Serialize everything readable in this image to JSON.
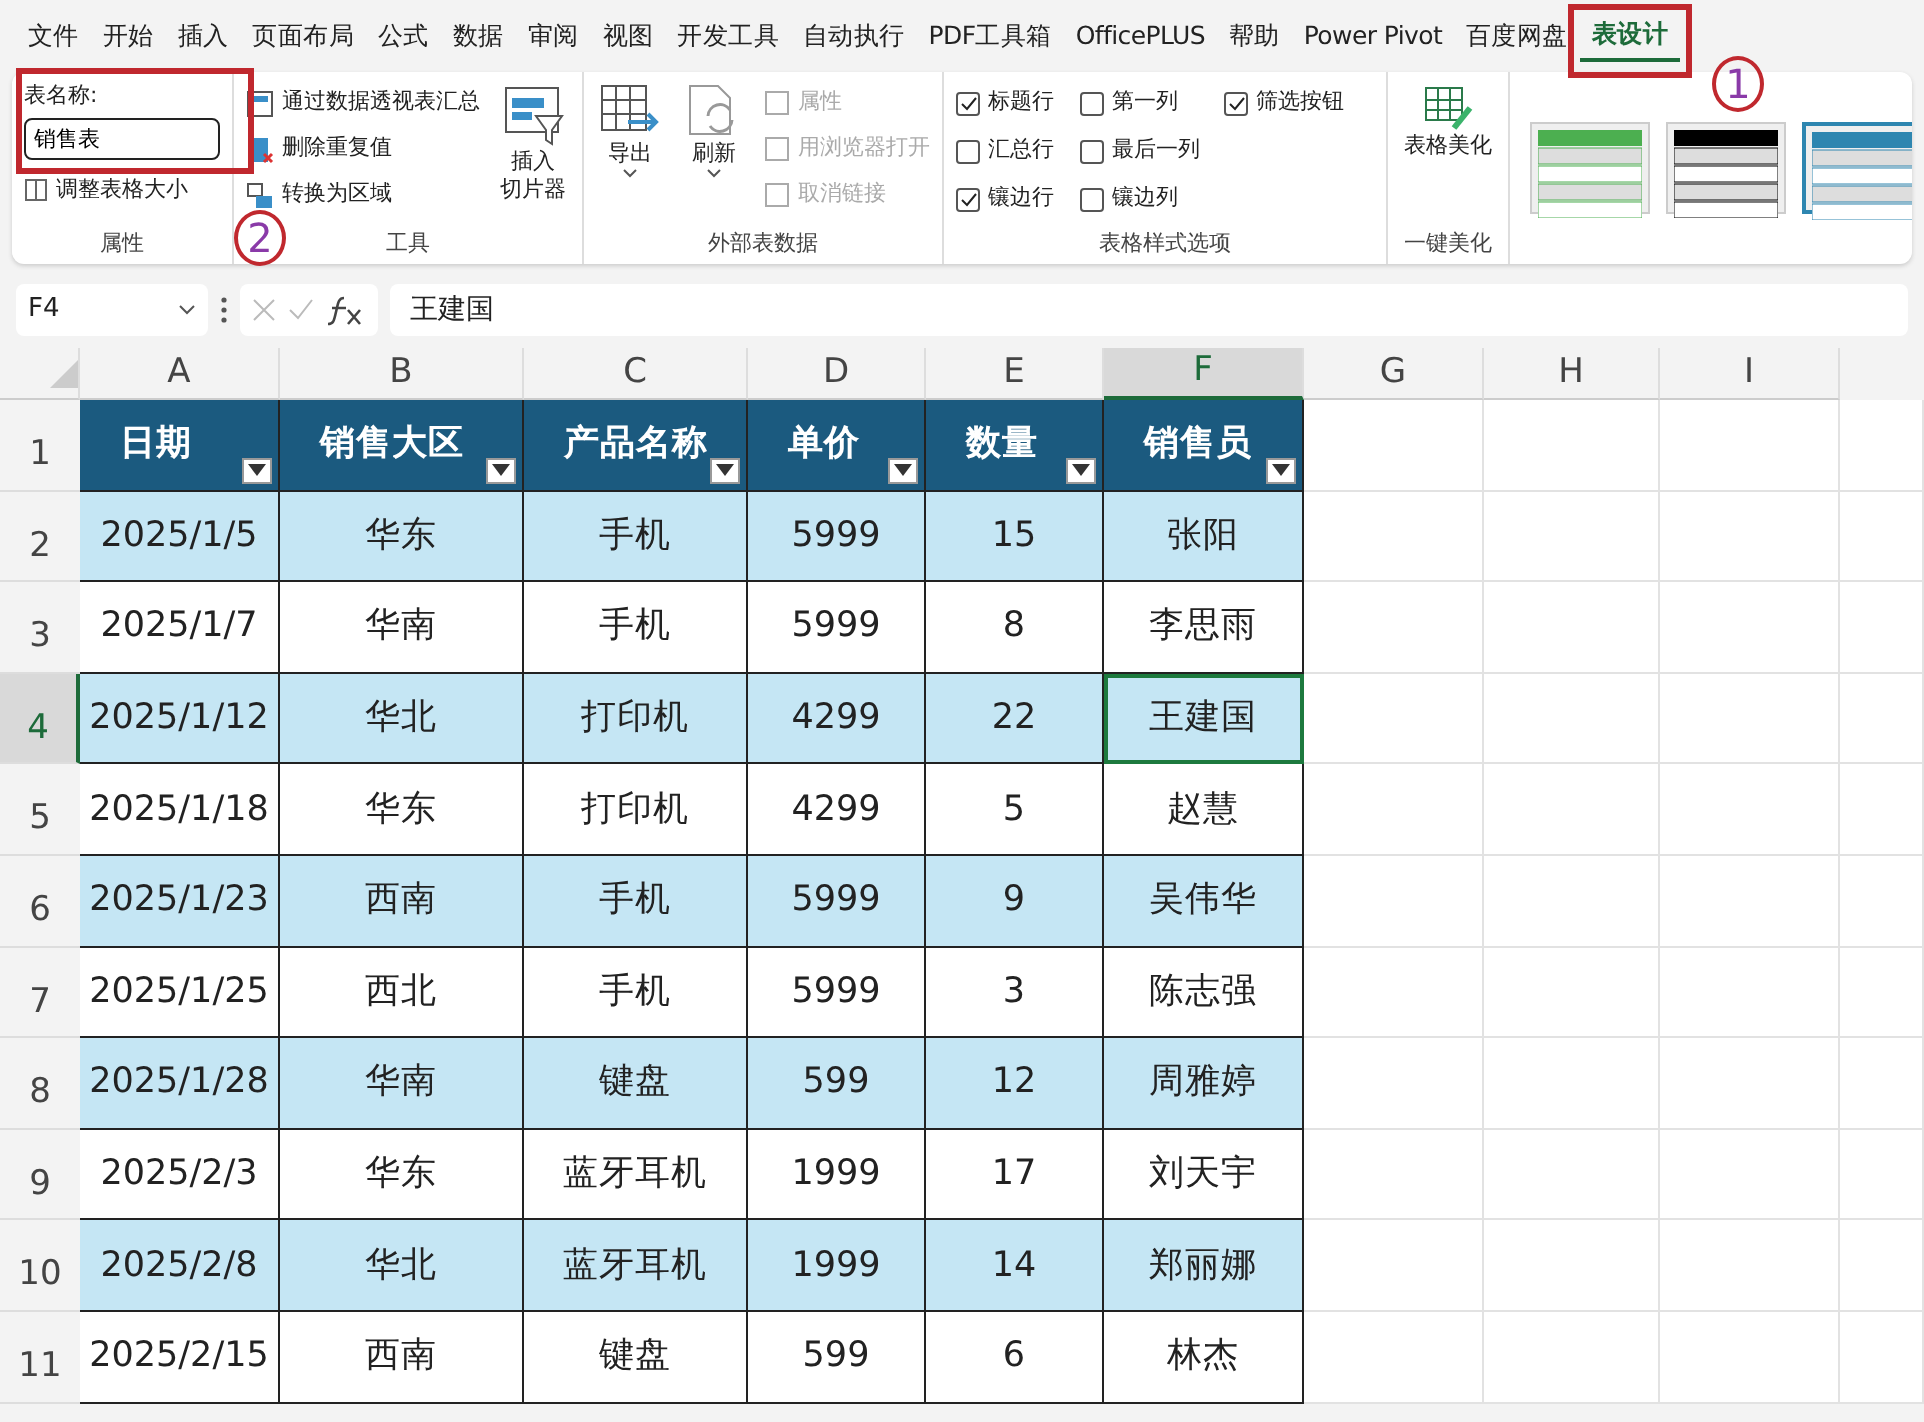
{
  "menu_tabs": [
    {
      "label": "文件",
      "selected": false
    },
    {
      "label": "开始",
      "selected": false
    },
    {
      "label": "插入",
      "selected": false
    },
    {
      "label": "页面布局",
      "selected": false
    },
    {
      "label": "公式",
      "selected": false
    },
    {
      "label": "数据",
      "selected": false
    },
    {
      "label": "审阅",
      "selected": false
    },
    {
      "label": "视图",
      "selected": false
    },
    {
      "label": "开发工具",
      "selected": false
    },
    {
      "label": "自动执行",
      "selected": false
    },
    {
      "label": "PDF工具箱",
      "selected": false
    },
    {
      "label": "OfficePLUS",
      "selected": false
    },
    {
      "label": "帮助",
      "selected": false
    },
    {
      "label": "Power Pivot",
      "selected": false
    },
    {
      "label": "百度网盘",
      "selected": false
    },
    {
      "label": "表设计",
      "selected": true
    }
  ],
  "ribbon": {
    "properties": {
      "name_label": "表名称:",
      "name_value": "销售表",
      "resize": "调整表格大小",
      "group": "属性"
    },
    "tools": {
      "items": [
        {
          "label": "通过数据透视表汇总",
          "kind": "pivot"
        },
        {
          "label": "删除重复值",
          "kind": "dedupe"
        },
        {
          "label": "转换为区域",
          "kind": "range"
        }
      ],
      "slicer": [
        "插入",
        "切片器"
      ],
      "group": "工具"
    },
    "external": {
      "export": "导出",
      "refresh": "刷新",
      "items": [
        {
          "label": "属性",
          "disabled": true
        },
        {
          "label": "用浏览器打开",
          "disabled": true
        },
        {
          "label": "取消链接",
          "disabled": true
        }
      ],
      "group": "外部表数据"
    },
    "style_options": {
      "options": [
        {
          "label": "标题行",
          "checked": true
        },
        {
          "label": "第一列",
          "checked": false
        },
        {
          "label": "筛选按钮",
          "checked": true
        },
        {
          "label": "汇总行",
          "checked": false
        },
        {
          "label": "最后一列",
          "checked": false
        },
        {
          "label": "镶边行",
          "checked": true
        },
        {
          "label": "镶边列",
          "checked": false
        }
      ],
      "group": "表格样式选项"
    },
    "beautify": {
      "button": "表格美化",
      "group": "一键美化"
    },
    "gallery": [
      {
        "color": "#4caf50",
        "selected": false
      },
      {
        "color": "#000000",
        "selected": false
      },
      {
        "color": "#2e86b0",
        "selected": true
      }
    ]
  },
  "formula_bar": {
    "name_box": "F4",
    "formula": "王建国"
  },
  "columns": [
    {
      "label": "A",
      "selected": false
    },
    {
      "label": "B",
      "selected": false
    },
    {
      "label": "C",
      "selected": false
    },
    {
      "label": "D",
      "selected": false
    },
    {
      "label": "E",
      "selected": false
    },
    {
      "label": "F",
      "selected": true
    },
    {
      "label": "G",
      "selected": false
    },
    {
      "label": "H",
      "selected": false
    },
    {
      "label": "I",
      "selected": false
    }
  ],
  "table": {
    "headers": [
      "日期",
      "销售大区",
      "产品名称",
      "单价",
      "数量",
      "销售员"
    ],
    "rows": [
      {
        "number": "2",
        "selected": false,
        "cells": [
          "2025/1/5",
          "华东",
          "手机",
          "5999",
          "15",
          "张阳"
        ]
      },
      {
        "number": "3",
        "selected": false,
        "cells": [
          "2025/1/7",
          "华南",
          "手机",
          "5999",
          "8",
          "李思雨"
        ]
      },
      {
        "number": "4",
        "selected": true,
        "cells": [
          "2025/1/12",
          "华北",
          "打印机",
          "4299",
          "22",
          "王建国"
        ]
      },
      {
        "number": "5",
        "selected": false,
        "cells": [
          "2025/1/18",
          "华东",
          "打印机",
          "4299",
          "5",
          "赵慧"
        ]
      },
      {
        "number": "6",
        "selected": false,
        "cells": [
          "2025/1/23",
          "西南",
          "手机",
          "5999",
          "9",
          "吴伟华"
        ]
      },
      {
        "number": "7",
        "selected": false,
        "cells": [
          "2025/1/25",
          "西北",
          "手机",
          "5999",
          "3",
          "陈志强"
        ]
      },
      {
        "number": "8",
        "selected": false,
        "cells": [
          "2025/1/28",
          "华南",
          "键盘",
          "599",
          "12",
          "周雅婷"
        ]
      },
      {
        "number": "9",
        "selected": false,
        "cells": [
          "2025/2/3",
          "华东",
          "蓝牙耳机",
          "1999",
          "17",
          "刘天宇"
        ]
      },
      {
        "number": "10",
        "selected": false,
        "cells": [
          "2025/2/8",
          "华北",
          "蓝牙耳机",
          "1999",
          "14",
          "郑丽娜"
        ]
      },
      {
        "number": "11",
        "selected": false,
        "cells": [
          "2025/2/15",
          "西南",
          "键盘",
          "599",
          "6",
          "林杰"
        ]
      }
    ]
  },
  "header_row_number": "1",
  "annotations": [
    {
      "label": "1",
      "kind": "tab"
    },
    {
      "label": "2",
      "kind": "group"
    }
  ]
}
